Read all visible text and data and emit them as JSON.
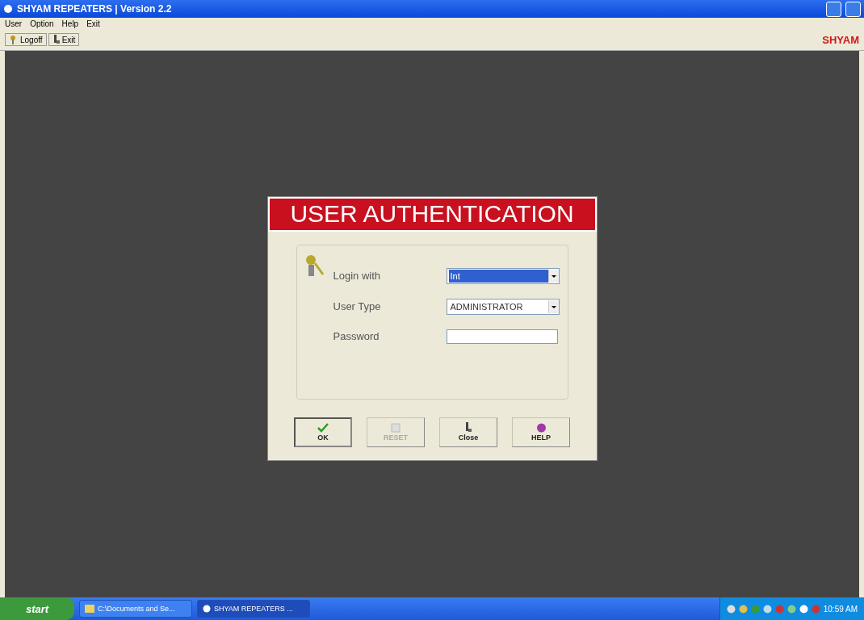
{
  "window": {
    "title": "SHYAM REPEATERS  |  Version 2.2"
  },
  "menu": [
    "User",
    "Option",
    "Help",
    "Exit"
  ],
  "toolbar": [
    {
      "label": "Logoff",
      "kind": "keys"
    },
    {
      "label": "Exit",
      "kind": "exit"
    }
  ],
  "brand": "SHYAM",
  "dialog": {
    "title": "USER AUTHENTICATION",
    "fields": [
      {
        "label": "Login with",
        "kind": "select",
        "value": "Int",
        "selected": true
      },
      {
        "label": "User Type",
        "kind": "select",
        "value": "ADMINISTRATOR",
        "selected": false
      },
      {
        "label": "Password",
        "kind": "password"
      }
    ],
    "buttons": [
      {
        "label": "OK",
        "kind": "ok",
        "disabled": false,
        "default": true
      },
      {
        "label": "RESET",
        "kind": "reset",
        "disabled": true,
        "default": false
      },
      {
        "label": "Close",
        "kind": "close",
        "disabled": false,
        "default": false
      },
      {
        "label": "HELP",
        "kind": "help",
        "disabled": false,
        "default": false
      }
    ]
  },
  "taskbar": {
    "start": "start",
    "tasks": [
      {
        "label": "C:\\Documents and Se...",
        "kind": "folder",
        "selected": false
      },
      {
        "label": "SHYAM REPEATERS ...",
        "kind": "app",
        "selected": true
      }
    ],
    "clock": "10:59 AM"
  }
}
